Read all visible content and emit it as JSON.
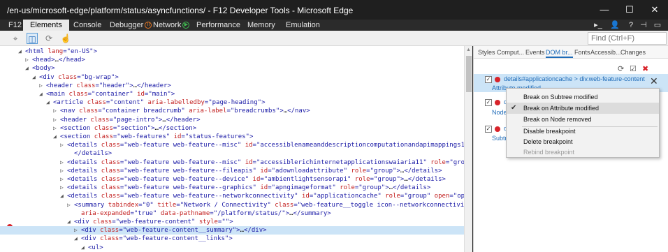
{
  "window": {
    "title": "/en-us/microsoft-edge/platform/status/asyncfunctions/ - F12 Developer Tools - Microsoft Edge",
    "buttons": {
      "minimize": "—",
      "maximize": "☐",
      "close": "✕"
    }
  },
  "tabs": [
    {
      "label": "F12"
    },
    {
      "label": "Elements"
    },
    {
      "label": "Console"
    },
    {
      "label": "Debugger"
    },
    {
      "label": "Network"
    },
    {
      "label": "Performance"
    },
    {
      "label": "Memory"
    },
    {
      "label": "Emulation"
    }
  ],
  "tab_badges": {
    "debugger": "II",
    "network": "▶"
  },
  "right_icons": {
    "console": "▸_",
    "feedback": "👤",
    "help": "?",
    "pin": "⊣",
    "dock": "▭"
  },
  "find": {
    "placeholder": "Find (Ctrl+F)"
  },
  "subtools": {
    "select": "⌖",
    "highlight": "◫",
    "refresh": "⟳",
    "touch": "☝"
  },
  "tree": [
    {
      "indent": 0,
      "arrow": "◢",
      "parts": [
        [
          "tag",
          "<html "
        ],
        [
          "an",
          "lang"
        ],
        [
          "tag",
          "="
        ],
        [
          "av",
          "\"en-US\""
        ],
        [
          "tag",
          ">"
        ]
      ]
    },
    {
      "indent": 1,
      "arrow": "▷",
      "parts": [
        [
          "tag",
          "<head>"
        ],
        [
          "txt",
          "…"
        ],
        [
          "tag",
          "</head>"
        ]
      ]
    },
    {
      "indent": 1,
      "arrow": "◢",
      "parts": [
        [
          "tag",
          "<body>"
        ]
      ]
    },
    {
      "indent": 2,
      "arrow": "◢",
      "parts": [
        [
          "tag",
          "<div "
        ],
        [
          "an",
          "class"
        ],
        [
          "tag",
          "="
        ],
        [
          "av",
          "\"bg-wrap\""
        ],
        [
          "tag",
          ">"
        ]
      ]
    },
    {
      "indent": 3,
      "arrow": "▷",
      "parts": [
        [
          "tag",
          "<header "
        ],
        [
          "an",
          "class"
        ],
        [
          "tag",
          "="
        ],
        [
          "av",
          "\"header\""
        ],
        [
          "tag",
          ">"
        ],
        [
          "txt",
          "…"
        ],
        [
          "tag",
          "</header>"
        ]
      ]
    },
    {
      "indent": 3,
      "arrow": "◢",
      "parts": [
        [
          "tag",
          "<main "
        ],
        [
          "an",
          "class"
        ],
        [
          "tag",
          "="
        ],
        [
          "av",
          "\"container\""
        ],
        [
          "tag",
          " "
        ],
        [
          "an",
          "id"
        ],
        [
          "tag",
          "="
        ],
        [
          "av",
          "\"main\""
        ],
        [
          "tag",
          ">"
        ]
      ]
    },
    {
      "indent": 4,
      "arrow": "◢",
      "parts": [
        [
          "tag",
          "<article "
        ],
        [
          "an",
          "class"
        ],
        [
          "tag",
          "="
        ],
        [
          "av",
          "\"content\""
        ],
        [
          "tag",
          " "
        ],
        [
          "an",
          "aria-labelledby"
        ],
        [
          "tag",
          "="
        ],
        [
          "av",
          "\"page-heading\""
        ],
        [
          "tag",
          ">"
        ]
      ]
    },
    {
      "indent": 5,
      "arrow": "▷",
      "parts": [
        [
          "tag",
          "<nav "
        ],
        [
          "an",
          "class"
        ],
        [
          "tag",
          "="
        ],
        [
          "av",
          "\"container breadcrumb\""
        ],
        [
          "tag",
          " "
        ],
        [
          "an",
          "aria-label"
        ],
        [
          "tag",
          "="
        ],
        [
          "av",
          "\"breadcrumbs\""
        ],
        [
          "tag",
          ">"
        ],
        [
          "txt",
          "…"
        ],
        [
          "tag",
          "</nav>"
        ]
      ]
    },
    {
      "indent": 5,
      "arrow": "▷",
      "parts": [
        [
          "tag",
          "<header "
        ],
        [
          "an",
          "class"
        ],
        [
          "tag",
          "="
        ],
        [
          "av",
          "\"page-intro\""
        ],
        [
          "tag",
          ">"
        ],
        [
          "txt",
          "…"
        ],
        [
          "tag",
          "</header>"
        ]
      ]
    },
    {
      "indent": 5,
      "arrow": "▷",
      "parts": [
        [
          "tag",
          "<section "
        ],
        [
          "an",
          "class"
        ],
        [
          "tag",
          "="
        ],
        [
          "av",
          "\"section\""
        ],
        [
          "tag",
          ">"
        ],
        [
          "txt",
          "…"
        ],
        [
          "tag",
          "</section>"
        ]
      ]
    },
    {
      "indent": 5,
      "arrow": "◢",
      "parts": [
        [
          "tag",
          "<section "
        ],
        [
          "an",
          "class"
        ],
        [
          "tag",
          "="
        ],
        [
          "av",
          "\"web-features\""
        ],
        [
          "tag",
          " "
        ],
        [
          "an",
          "id"
        ],
        [
          "tag",
          "="
        ],
        [
          "av",
          "\"status-features\""
        ],
        [
          "tag",
          ">"
        ]
      ]
    },
    {
      "indent": 6,
      "arrow": "▷",
      "parts": [
        [
          "tag",
          "<details "
        ],
        [
          "an",
          "class"
        ],
        [
          "tag",
          "="
        ],
        [
          "av",
          "\"web-feature web-feature--misc\""
        ],
        [
          "tag",
          " "
        ],
        [
          "an",
          "id"
        ],
        [
          "tag",
          "="
        ],
        [
          "av",
          "\"accessiblenameanddescriptioncomputationandapimappings11\""
        ],
        [
          "tag",
          " "
        ],
        [
          "an",
          "role"
        ],
        [
          "tag",
          "="
        ],
        [
          "av",
          "\"group\""
        ],
        [
          "tag",
          ">…"
        ]
      ]
    },
    {
      "indent": 7,
      "arrow": "",
      "parts": [
        [
          "tag",
          "</details>"
        ]
      ]
    },
    {
      "indent": 6,
      "arrow": "▷",
      "parts": [
        [
          "tag",
          "<details "
        ],
        [
          "an",
          "class"
        ],
        [
          "tag",
          "="
        ],
        [
          "av",
          "\"web-feature web-feature--misc\""
        ],
        [
          "tag",
          " "
        ],
        [
          "an",
          "id"
        ],
        [
          "tag",
          "="
        ],
        [
          "av",
          "\"accessiblerichinternetapplicationswaiaria11\""
        ],
        [
          "tag",
          " "
        ],
        [
          "an",
          "role"
        ],
        [
          "tag",
          "="
        ],
        [
          "av",
          "\"group\""
        ],
        [
          "tag",
          ">"
        ],
        [
          "txt",
          "…"
        ],
        [
          "tag",
          "</details>"
        ]
      ]
    },
    {
      "indent": 6,
      "arrow": "▷",
      "parts": [
        [
          "tag",
          "<details "
        ],
        [
          "an",
          "class"
        ],
        [
          "tag",
          "="
        ],
        [
          "av",
          "\"web-feature web-feature--fileapis\""
        ],
        [
          "tag",
          " "
        ],
        [
          "an",
          "id"
        ],
        [
          "tag",
          "="
        ],
        [
          "av",
          "\"adownloadattribute\""
        ],
        [
          "tag",
          " "
        ],
        [
          "an",
          "role"
        ],
        [
          "tag",
          "="
        ],
        [
          "av",
          "\"group\""
        ],
        [
          "tag",
          ">"
        ],
        [
          "txt",
          "…"
        ],
        [
          "tag",
          "</details>"
        ]
      ]
    },
    {
      "indent": 6,
      "arrow": "▷",
      "parts": [
        [
          "tag",
          "<details "
        ],
        [
          "an",
          "class"
        ],
        [
          "tag",
          "="
        ],
        [
          "av",
          "\"web-feature web-feature--device\""
        ],
        [
          "tag",
          " "
        ],
        [
          "an",
          "id"
        ],
        [
          "tag",
          "="
        ],
        [
          "av",
          "\"ambientlightsensorapi\""
        ],
        [
          "tag",
          " "
        ],
        [
          "an",
          "role"
        ],
        [
          "tag",
          "="
        ],
        [
          "av",
          "\"group\""
        ],
        [
          "tag",
          ">"
        ],
        [
          "txt",
          "…"
        ],
        [
          "tag",
          "</details>"
        ]
      ]
    },
    {
      "indent": 6,
      "arrow": "▷",
      "parts": [
        [
          "tag",
          "<details "
        ],
        [
          "an",
          "class"
        ],
        [
          "tag",
          "="
        ],
        [
          "av",
          "\"web-feature web-feature--graphics\""
        ],
        [
          "tag",
          " "
        ],
        [
          "an",
          "id"
        ],
        [
          "tag",
          "="
        ],
        [
          "av",
          "\"apngimageformat\""
        ],
        [
          "tag",
          " "
        ],
        [
          "an",
          "role"
        ],
        [
          "tag",
          "="
        ],
        [
          "av",
          "\"group\""
        ],
        [
          "tag",
          ">"
        ],
        [
          "txt",
          "…"
        ],
        [
          "tag",
          "</details>"
        ]
      ]
    },
    {
      "indent": 6,
      "arrow": "◢",
      "parts": [
        [
          "tag",
          "<details "
        ],
        [
          "an",
          "class"
        ],
        [
          "tag",
          "="
        ],
        [
          "av",
          "\"web-feature web-feature--networkconnectivity\""
        ],
        [
          "tag",
          " "
        ],
        [
          "an",
          "id"
        ],
        [
          "tag",
          "="
        ],
        [
          "av",
          "\"applicationcache\""
        ],
        [
          "tag",
          " "
        ],
        [
          "an",
          "role"
        ],
        [
          "tag",
          "="
        ],
        [
          "av",
          "\"group\""
        ],
        [
          "tag",
          " "
        ],
        [
          "an",
          "open"
        ],
        [
          "tag",
          "="
        ],
        [
          "av",
          "\"open\""
        ],
        [
          "tag",
          ">"
        ]
      ]
    },
    {
      "indent": 7,
      "arrow": "▷",
      "parts": [
        [
          "tag",
          "<summary "
        ],
        [
          "an",
          "tabindex"
        ],
        [
          "tag",
          "="
        ],
        [
          "av",
          "\"0\""
        ],
        [
          "tag",
          " "
        ],
        [
          "an",
          "title"
        ],
        [
          "tag",
          "="
        ],
        [
          "av",
          "\"Network / Connectivity\""
        ],
        [
          "tag",
          " "
        ],
        [
          "an",
          "class"
        ],
        [
          "tag",
          "="
        ],
        [
          "av",
          "\"web-feature__toggle icon--networkconnectivity\""
        ],
        [
          "tag",
          " "
        ],
        [
          "an",
          "role"
        ],
        [
          "tag",
          "="
        ],
        [
          "av",
          "\"button\""
        ]
      ]
    },
    {
      "indent": 8,
      "arrow": "",
      "parts": [
        [
          "an",
          "aria-expanded"
        ],
        [
          "tag",
          "="
        ],
        [
          "av",
          "\"true\""
        ],
        [
          "tag",
          " "
        ],
        [
          "an",
          "data-pathname"
        ],
        [
          "tag",
          "="
        ],
        [
          "av",
          "\"/platform/status/\""
        ],
        [
          "tag",
          ">"
        ],
        [
          "txt",
          "…"
        ],
        [
          "tag",
          "</summary>"
        ]
      ]
    },
    {
      "indent": 7,
      "arrow": "◢",
      "parts": [
        [
          "tag",
          "<div "
        ],
        [
          "an",
          "class"
        ],
        [
          "tag",
          "="
        ],
        [
          "av",
          "\"web-feature-content\""
        ],
        [
          "tag",
          " "
        ],
        [
          "an",
          "style"
        ],
        [
          "tag",
          "="
        ],
        [
          "av",
          "\"\""
        ],
        [
          "tag",
          ">"
        ]
      ]
    },
    {
      "indent": 8,
      "arrow": "▷",
      "parts": [
        [
          "tag",
          "<div "
        ],
        [
          "an",
          "class"
        ],
        [
          "tag",
          "="
        ],
        [
          "av",
          "\"web-feature-content__summary\""
        ],
        [
          "tag",
          ">"
        ],
        [
          "txt",
          "…"
        ],
        [
          "tag",
          "</div>"
        ]
      ]
    },
    {
      "indent": 8,
      "arrow": "◢",
      "parts": [
        [
          "tag",
          "<div "
        ],
        [
          "an",
          "class"
        ],
        [
          "tag",
          "="
        ],
        [
          "av",
          "\"web-feature-content__links\""
        ],
        [
          "tag",
          ">"
        ]
      ]
    },
    {
      "indent": 9,
      "arrow": "◢",
      "parts": [
        [
          "tag",
          "<ul>"
        ]
      ]
    }
  ],
  "right_panel": {
    "tabs": [
      "Styles",
      "Comput...",
      "Events",
      "DOM br...",
      "Fonts",
      "Accessib...",
      "Changes"
    ],
    "icons": {
      "refresh": "⟳",
      "check": "☑",
      "delete": "✖"
    },
    "breakpoints": [
      {
        "title": "details#applicationcache > div.web-feature-content",
        "subtitle": "Attribute modified"
      },
      {
        "title": "d",
        "subtitle": "Node"
      },
      {
        "title": "d",
        "subtitle": "Subtre"
      }
    ],
    "check_glyph": "✓",
    "close_glyph": "✕"
  },
  "context_menu": {
    "check_glyph": "✔",
    "items": [
      {
        "label": "Break on Subtree modified"
      },
      {
        "label": "Break on Attribute modified"
      },
      {
        "label": "Break on Node removed"
      },
      {
        "label": "Disable breakpoint"
      },
      {
        "label": "Delete breakpoint"
      },
      {
        "label": "Rebind breakpoint"
      }
    ]
  }
}
